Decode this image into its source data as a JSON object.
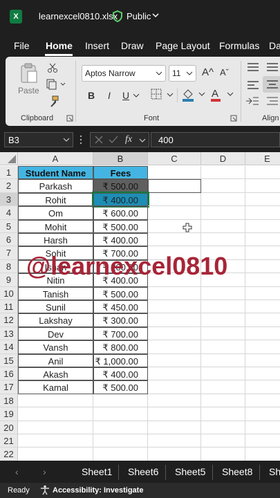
{
  "title": {
    "filename": "learnexcel0810.xlsx",
    "visibility": "Public"
  },
  "menu": [
    "File",
    "Home",
    "Insert",
    "Draw",
    "Page Layout",
    "Formulas",
    "Da"
  ],
  "ribbon": {
    "paste_label": "Paste",
    "clipboard_label": "Clipboard",
    "font_name": "Aptos Narrow",
    "font_size": "11",
    "bold": "B",
    "italic": "I",
    "underline": "U",
    "font_group_label": "Font",
    "align_label": "Align",
    "grow_font": "A^",
    "shrink_font": "Aˇ"
  },
  "formula_bar": {
    "name_box": "B3",
    "fx": "fx",
    "value": "400"
  },
  "columns": [
    "A",
    "B",
    "C",
    "D",
    "E"
  ],
  "rows": [
    "1",
    "2",
    "3",
    "4",
    "5",
    "6",
    "7",
    "8",
    "9",
    "10",
    "11",
    "12",
    "13",
    "14",
    "15",
    "16",
    "17",
    "18",
    "19",
    "20",
    "21",
    "22"
  ],
  "table": {
    "header_name": "Student Name",
    "header_fees": "Fees",
    "records": [
      {
        "name": "Parkash",
        "fee": "₹ 500.00"
      },
      {
        "name": "Rohit",
        "fee": "₹ 400.00"
      },
      {
        "name": "Om",
        "fee": "₹ 600.00"
      },
      {
        "name": "Mohit",
        "fee": "₹ 500.00"
      },
      {
        "name": "Harsh",
        "fee": "₹ 400.00"
      },
      {
        "name": "Sohit",
        "fee": "₹ 700.00"
      },
      {
        "name": "Ishan",
        "fee": "₹ 200.00"
      },
      {
        "name": "Nitin",
        "fee": "₹ 400.00"
      },
      {
        "name": "Tanish",
        "fee": "₹ 500.00"
      },
      {
        "name": "Sunil",
        "fee": "₹ 450.00"
      },
      {
        "name": "Lakshay",
        "fee": "₹ 300.00"
      },
      {
        "name": "Dev",
        "fee": "₹ 700.00"
      },
      {
        "name": "Vansh",
        "fee": "₹ 800.00"
      },
      {
        "name": "Anil",
        "fee": "₹ 1,000.00"
      },
      {
        "name": "Akash",
        "fee": "₹ 400.00"
      },
      {
        "name": "Kamal",
        "fee": "₹ 500.00"
      }
    ]
  },
  "watermark": "@learnexcel0810",
  "sheet_tabs": [
    "Sheet1",
    "Sheet6",
    "Sheet5",
    "Sheet8",
    "Sh"
  ],
  "status": {
    "ready": "Ready",
    "accessibility": "Accessibility: Investigate"
  },
  "colors": {
    "header_fill": "#44b5e2",
    "active_cell": "#1d8eb5",
    "watermark": "#a72538",
    "excel_green": "#107c41"
  }
}
